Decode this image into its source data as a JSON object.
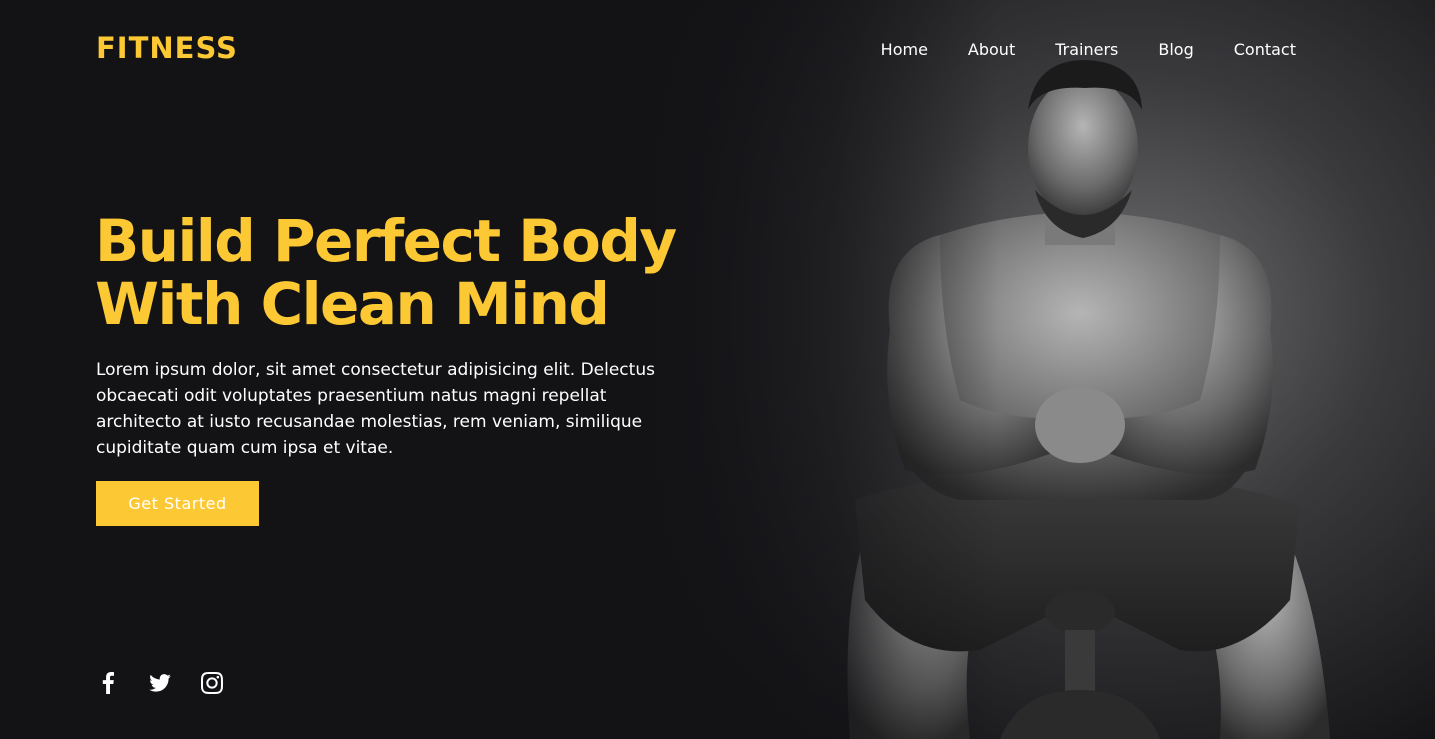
{
  "brand": {
    "logo_text": "FITNESS",
    "accent_color": "#fcc934"
  },
  "nav": {
    "items": [
      {
        "label": "Home"
      },
      {
        "label": "About"
      },
      {
        "label": "Trainers"
      },
      {
        "label": "Blog"
      },
      {
        "label": "Contact"
      }
    ]
  },
  "hero": {
    "headline_line1": "Build Perfect Body",
    "headline_line2": "With Clean Mind",
    "description": "Lorem ipsum dolor, sit amet consectetur adipisicing elit. Delectus obcaecati odit voluptates praesentium natus magni repellat architecto at iusto recusandae molestias, rem veniam, similique cupiditate quam cum ipsa et vitae.",
    "cta_label": "Get Started",
    "image_subject": "muscular man sitting on gym equipment, black and white photo"
  },
  "social": {
    "icons": [
      "facebook-icon",
      "twitter-icon",
      "instagram-icon"
    ]
  },
  "colors": {
    "background": "#131316",
    "text": "#ffffff"
  }
}
